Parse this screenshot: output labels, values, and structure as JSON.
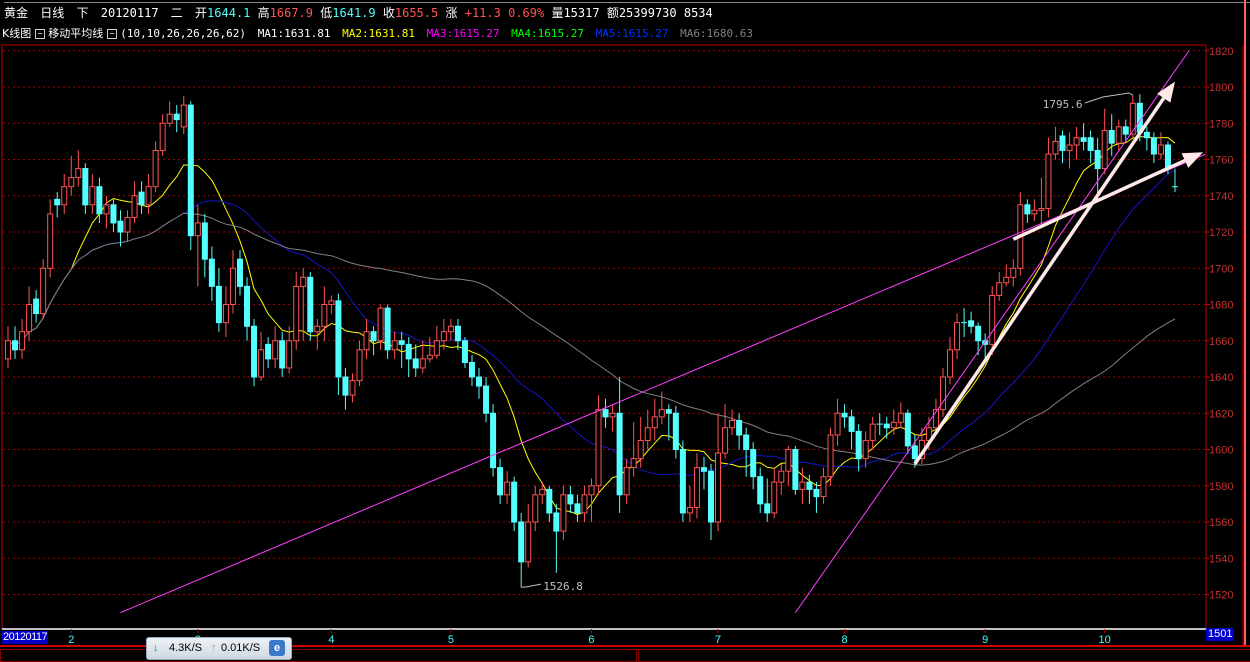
{
  "header": {
    "symbol": "黄金",
    "period": "日线",
    "down_label": "下",
    "date": "20120117",
    "weekday": "二",
    "open_label": "开",
    "open": "1644.1",
    "high_label": "高",
    "high": "1667.9",
    "low_label": "低",
    "low": "1641.9",
    "close_label": "收",
    "close": "1655.5",
    "change_label": "涨",
    "change": "+11.3",
    "change_pct": "0.69%",
    "volume_label": "量",
    "volume": "15317",
    "amount_label": "额",
    "amount": "25399730",
    "extra": "8534"
  },
  "indicator_bar": {
    "chart_type": "K线图",
    "indicator": "移动平均线",
    "params": "(10,10,26,26,26,62)",
    "ma": [
      {
        "label": "MA1:1631.81",
        "color": "#ffffff"
      },
      {
        "label": "MA2:1631.81",
        "color": "#ffff00"
      },
      {
        "label": "MA3:1615.27",
        "color": "#ff00ff"
      },
      {
        "label": "MA4:1615.27",
        "color": "#00ff00"
      },
      {
        "label": "MA5:1615.27",
        "color": "#0033ff"
      },
      {
        "label": "MA6:1680.63",
        "color": "#808080"
      }
    ]
  },
  "status_widget": {
    "down_speed": "4.3K/S",
    "up_speed": "0.01K/S"
  },
  "footer": {
    "date_label": "20120117",
    "count_label": "1501"
  },
  "chart_data": {
    "type": "candlestick",
    "title": "",
    "ylim": [
      1510,
      1825
    ],
    "y_ticks": [
      "1820",
      "1800",
      "1780",
      "1760",
      "1740",
      "1720",
      "1700",
      "1680",
      "1660",
      "1640",
      "1620",
      "1600",
      "1580",
      "1560",
      "1540",
      "1520"
    ],
    "grid": true,
    "x_tick_labels": [
      {
        "label": "2",
        "index": 9
      },
      {
        "label": "3",
        "index": 27
      },
      {
        "label": "4",
        "index": 46
      },
      {
        "label": "5",
        "index": 63
      },
      {
        "label": "6",
        "index": 83
      },
      {
        "label": "7",
        "index": 101
      },
      {
        "label": "8",
        "index": 119
      },
      {
        "label": "9",
        "index": 139
      },
      {
        "label": "10",
        "index": 156
      }
    ],
    "up_color": "#ff5454",
    "down_color": "#54ffff",
    "moving_averages": [
      {
        "period": 10,
        "color": "#ffff00"
      },
      {
        "period": 26,
        "color": "#1414c8"
      },
      {
        "period": 62,
        "color": "#808080"
      }
    ],
    "annotations": [
      {
        "text": "1795.6",
        "index": 160,
        "price": 1795.6
      },
      {
        "text": "1526.8",
        "index": 73,
        "price": 1526.8
      }
    ],
    "ohlc": [
      [
        1650,
        1668,
        1645,
        1660
      ],
      [
        1660,
        1668,
        1650,
        1655
      ],
      [
        1655,
        1672,
        1650,
        1665
      ],
      [
        1665,
        1690,
        1660,
        1680
      ],
      [
        1683,
        1688,
        1670,
        1675
      ],
      [
        1675,
        1705,
        1672,
        1700
      ],
      [
        1700,
        1738,
        1695,
        1730
      ],
      [
        1738,
        1742,
        1728,
        1735
      ],
      [
        1735,
        1752,
        1730,
        1745
      ],
      [
        1745,
        1762,
        1740,
        1750
      ],
      [
        1750,
        1765,
        1745,
        1755
      ],
      [
        1755,
        1758,
        1730,
        1735
      ],
      [
        1735,
        1752,
        1730,
        1745
      ],
      [
        1745,
        1750,
        1725,
        1730
      ],
      [
        1730,
        1740,
        1722,
        1735
      ],
      [
        1735,
        1738,
        1720,
        1725
      ],
      [
        1726,
        1732,
        1712,
        1720
      ],
      [
        1720,
        1732,
        1715,
        1728
      ],
      [
        1728,
        1748,
        1725,
        1740
      ],
      [
        1742,
        1748,
        1730,
        1735
      ],
      [
        1735,
        1752,
        1730,
        1745
      ],
      [
        1745,
        1770,
        1742,
        1765
      ],
      [
        1765,
        1785,
        1762,
        1780
      ],
      [
        1780,
        1792,
        1778,
        1785
      ],
      [
        1785,
        1790,
        1775,
        1782
      ],
      [
        1778,
        1795,
        1774,
        1790
      ],
      [
        1790,
        1792,
        1710,
        1718
      ],
      [
        1718,
        1735,
        1690,
        1725
      ],
      [
        1725,
        1730,
        1695,
        1705
      ],
      [
        1705,
        1712,
        1682,
        1690
      ],
      [
        1690,
        1700,
        1665,
        1670
      ],
      [
        1670,
        1690,
        1662,
        1680
      ],
      [
        1680,
        1710,
        1675,
        1700
      ],
      [
        1705,
        1710,
        1685,
        1690
      ],
      [
        1690,
        1695,
        1660,
        1668
      ],
      [
        1668,
        1672,
        1635,
        1640
      ],
      [
        1640,
        1665,
        1638,
        1655
      ],
      [
        1658,
        1662,
        1645,
        1650
      ],
      [
        1650,
        1668,
        1645,
        1660
      ],
      [
        1660,
        1665,
        1640,
        1645
      ],
      [
        1645,
        1668,
        1642,
        1660
      ],
      [
        1660,
        1698,
        1655,
        1690
      ],
      [
        1690,
        1700,
        1660,
        1695
      ],
      [
        1695,
        1698,
        1660,
        1665
      ],
      [
        1665,
        1672,
        1655,
        1668
      ],
      [
        1668,
        1690,
        1660,
        1680
      ],
      [
        1680,
        1685,
        1675,
        1682
      ],
      [
        1682,
        1686,
        1630,
        1640
      ],
      [
        1640,
        1645,
        1622,
        1630
      ],
      [
        1630,
        1642,
        1626,
        1638
      ],
      [
        1638,
        1660,
        1635,
        1655
      ],
      [
        1655,
        1672,
        1650,
        1665
      ],
      [
        1665,
        1668,
        1652,
        1660
      ],
      [
        1660,
        1680,
        1655,
        1678
      ],
      [
        1678,
        1680,
        1650,
        1655
      ],
      [
        1655,
        1665,
        1650,
        1660
      ],
      [
        1660,
        1665,
        1645,
        1658
      ],
      [
        1658,
        1662,
        1640,
        1650
      ],
      [
        1650,
        1658,
        1640,
        1645
      ],
      [
        1645,
        1660,
        1642,
        1650
      ],
      [
        1650,
        1662,
        1648,
        1652
      ],
      [
        1652,
        1668,
        1650,
        1660
      ],
      [
        1660,
        1672,
        1655,
        1665
      ],
      [
        1665,
        1672,
        1660,
        1668
      ],
      [
        1668,
        1672,
        1655,
        1660
      ],
      [
        1660,
        1662,
        1645,
        1648
      ],
      [
        1648,
        1652,
        1635,
        1640
      ],
      [
        1640,
        1645,
        1628,
        1635
      ],
      [
        1635,
        1640,
        1615,
        1620
      ],
      [
        1620,
        1625,
        1585,
        1590
      ],
      [
        1590,
        1595,
        1570,
        1575
      ],
      [
        1575,
        1588,
        1570,
        1582
      ],
      [
        1582,
        1585,
        1555,
        1560
      ],
      [
        1560,
        1565,
        1526.8,
        1538
      ],
      [
        1538,
        1570,
        1535,
        1560
      ],
      [
        1560,
        1580,
        1555,
        1575
      ],
      [
        1575,
        1582,
        1570,
        1578
      ],
      [
        1578,
        1580,
        1560,
        1565
      ],
      [
        1565,
        1570,
        1532,
        1555
      ],
      [
        1555,
        1580,
        1550,
        1575
      ],
      [
        1575,
        1580,
        1565,
        1570
      ],
      [
        1570,
        1575,
        1560,
        1565
      ],
      [
        1565,
        1580,
        1560,
        1575
      ],
      [
        1575,
        1584,
        1560,
        1580
      ],
      [
        1580,
        1630,
        1575,
        1622
      ],
      [
        1622,
        1628,
        1612,
        1618
      ],
      [
        1618,
        1625,
        1610,
        1620
      ],
      [
        1620,
        1640,
        1565,
        1575
      ],
      [
        1575,
        1595,
        1570,
        1590
      ],
      [
        1590,
        1615,
        1585,
        1595
      ],
      [
        1595,
        1618,
        1590,
        1605
      ],
      [
        1605,
        1622,
        1600,
        1612
      ],
      [
        1612,
        1628,
        1605,
        1618
      ],
      [
        1618,
        1632,
        1614,
        1622
      ],
      [
        1622,
        1625,
        1605,
        1620
      ],
      [
        1620,
        1624,
        1595,
        1600
      ],
      [
        1600,
        1605,
        1560,
        1565
      ],
      [
        1565,
        1580,
        1560,
        1568
      ],
      [
        1568,
        1598,
        1562,
        1590
      ],
      [
        1590,
        1596,
        1578,
        1588
      ],
      [
        1588,
        1592,
        1550,
        1560
      ],
      [
        1560,
        1620,
        1555,
        1598
      ],
      [
        1598,
        1625,
        1595,
        1612
      ],
      [
        1612,
        1622,
        1608,
        1616
      ],
      [
        1616,
        1620,
        1600,
        1608
      ],
      [
        1608,
        1612,
        1585,
        1600
      ],
      [
        1600,
        1604,
        1578,
        1585
      ],
      [
        1585,
        1590,
        1565,
        1570
      ],
      [
        1570,
        1584,
        1560,
        1565
      ],
      [
        1565,
        1590,
        1562,
        1582
      ],
      [
        1582,
        1592,
        1575,
        1588
      ],
      [
        1588,
        1602,
        1580,
        1600
      ],
      [
        1600,
        1602,
        1575,
        1578
      ],
      [
        1578,
        1590,
        1570,
        1582
      ],
      [
        1582,
        1586,
        1570,
        1578
      ],
      [
        1578,
        1582,
        1565,
        1574
      ],
      [
        1574,
        1590,
        1570,
        1585
      ],
      [
        1585,
        1612,
        1580,
        1608
      ],
      [
        1608,
        1628,
        1602,
        1620
      ],
      [
        1620,
        1625,
        1612,
        1618
      ],
      [
        1618,
        1622,
        1600,
        1610
      ],
      [
        1610,
        1614,
        1588,
        1595
      ],
      [
        1595,
        1610,
        1590,
        1605
      ],
      [
        1605,
        1618,
        1600,
        1614
      ],
      [
        1614,
        1620,
        1608,
        1614
      ],
      [
        1614,
        1618,
        1606,
        1612
      ],
      [
        1612,
        1622,
        1608,
        1615
      ],
      [
        1615,
        1626,
        1612,
        1620
      ],
      [
        1620,
        1622,
        1598,
        1602
      ],
      [
        1602,
        1608,
        1590,
        1595
      ],
      [
        1595,
        1612,
        1592,
        1605
      ],
      [
        1605,
        1618,
        1600,
        1612
      ],
      [
        1612,
        1628,
        1608,
        1622
      ],
      [
        1622,
        1645,
        1618,
        1640
      ],
      [
        1640,
        1662,
        1636,
        1655
      ],
      [
        1655,
        1675,
        1650,
        1670
      ],
      [
        1670,
        1678,
        1662,
        1670
      ],
      [
        1671,
        1676,
        1664,
        1668
      ],
      [
        1668,
        1670,
        1652,
        1660
      ],
      [
        1660,
        1664,
        1650,
        1658
      ],
      [
        1658,
        1690,
        1652,
        1685
      ],
      [
        1685,
        1698,
        1682,
        1692
      ],
      [
        1692,
        1702,
        1690,
        1695
      ],
      [
        1695,
        1705,
        1690,
        1700
      ],
      [
        1700,
        1742,
        1696,
        1735
      ],
      [
        1735,
        1738,
        1725,
        1730
      ],
      [
        1730,
        1738,
        1726,
        1732
      ],
      [
        1732,
        1750,
        1722,
        1733
      ],
      [
        1733,
        1772,
        1728,
        1763
      ],
      [
        1763,
        1778,
        1760,
        1770
      ],
      [
        1773,
        1776,
        1758,
        1765
      ],
      [
        1765,
        1775,
        1755,
        1768
      ],
      [
        1768,
        1778,
        1760,
        1772
      ],
      [
        1772,
        1780,
        1765,
        1770
      ],
      [
        1772,
        1776,
        1758,
        1765
      ],
      [
        1765,
        1772,
        1738,
        1755
      ],
      [
        1755,
        1788,
        1752,
        1776
      ],
      [
        1776,
        1785,
        1762,
        1769
      ],
      [
        1769,
        1782,
        1765,
        1778
      ],
      [
        1778,
        1782,
        1770,
        1774
      ],
      [
        1774,
        1795.6,
        1772,
        1791
      ],
      [
        1791,
        1796,
        1770,
        1775
      ],
      [
        1775,
        1778,
        1765,
        1772
      ],
      [
        1772,
        1775,
        1758,
        1763
      ],
      [
        1763,
        1775,
        1760,
        1768
      ],
      [
        1768,
        1770,
        1752,
        1755
      ],
      [
        1745,
        1755,
        1742,
        1745
      ]
    ],
    "trend_lines": [
      {
        "color": "#ff40ff",
        "from": {
          "index": 16,
          "price": 1510
        },
        "to": {
          "index": 171,
          "price": 1764
        }
      },
      {
        "color": "#ff40ff",
        "from": {
          "index": 112,
          "price": 1510
        },
        "to": {
          "index": 168,
          "price": 1820
        }
      }
    ],
    "arrows": [
      {
        "color": "#ffe8e8",
        "from": {
          "index": 129,
          "price": 1592
        },
        "to": {
          "index": 166,
          "price": 1803
        }
      },
      {
        "color": "#ffe8e8",
        "from": {
          "index": 143,
          "price": 1716
        },
        "to": {
          "index": 170,
          "price": 1764
        }
      }
    ]
  }
}
